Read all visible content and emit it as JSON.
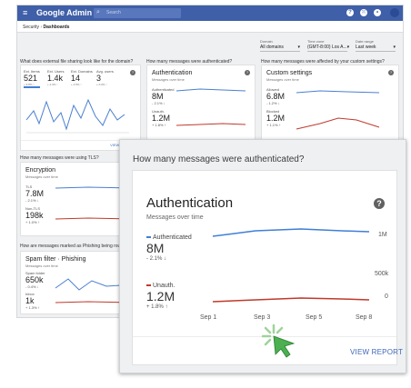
{
  "topbar": {
    "brand": "Google Admin",
    "search_placeholder": "Search",
    "icons": [
      "help-icon",
      "apps-icon",
      "notifications-icon"
    ],
    "colors": {
      "header": "#3f5fa8",
      "accent": "#3f7fd6",
      "unauth": "#c0392b"
    }
  },
  "breadcrumb": {
    "parent": "Security",
    "current": "Dashboards"
  },
  "filters": [
    {
      "label": "Domain",
      "value": "All domains"
    },
    {
      "label": "Time zone",
      "value": "(GMT-8:00) Los A..."
    },
    {
      "label": "Date range",
      "value": "Last week"
    }
  ],
  "dashboard": {
    "questions": {
      "external_sharing": "What does external file sharing look like for the domain?",
      "authenticated": "How many messages were authenticated?",
      "custom": "How many messages were affected by your custom settings?",
      "tls": "How many messages were using TLS?",
      "phishing": "How are messages marked as Phishing being routed?"
    },
    "sharing_stats": [
      {
        "label": "Ext. Items",
        "value": "521",
        "change": "+ 9.8% ↑"
      },
      {
        "label": "Ext. Users",
        "value": "1.4k",
        "change": "+ 2.3% ↑"
      },
      {
        "label": "Ext. Domains",
        "value": "14",
        "change": "+ 4.5% ↑"
      },
      {
        "label": "Avg. users",
        "value": "3",
        "change": "+ 0.0% ↑"
      }
    ],
    "small_auth": {
      "title": "Authentication",
      "subtitle": "Messages over time",
      "a_label": "Authenticated",
      "a_value": "8M",
      "a_change": "- 2.1% ↓",
      "u_label": "Unauth.",
      "u_value": "1.2M",
      "u_change": "+ 1.8% ↑",
      "view": "VIEW REPORT"
    },
    "custom": {
      "title": "Custom settings",
      "subtitle": "Messages over time",
      "a_label": "Allowed",
      "a_value": "6.8M",
      "a_change": "- 1.2% ↓",
      "b_label": "Blocked",
      "b_value": "1.2M",
      "b_change": "+ 1.1% ↑",
      "view": "VIEW REPORT"
    },
    "tls": {
      "title": "Encryption",
      "subtitle": "Messages over time",
      "a_label": "TLS",
      "a_value": "7.8M",
      "a_change": "- 2.1% ↓",
      "b_label": "Non-TLS",
      "b_value": "198k",
      "b_change": "+ 1.0% ↑"
    },
    "spam": {
      "title": "Spam filter · Phishing",
      "subtitle": "Messages over time",
      "a_label": "Spam folder",
      "a_value": "650k",
      "a_change": "- 0.4% ↓",
      "b_label": "Inbox",
      "b_value": "1k",
      "b_change": "+ 1.3% ↑"
    },
    "sharing_view": "VIEW REPORT"
  },
  "zoom": {
    "question": "How many messages were authenticated?",
    "title": "Authentication",
    "subtitle": "Messages over time",
    "help": "?",
    "authenticated_label": "Authenticated",
    "authenticated_value": "8M",
    "authenticated_change": "- 2.1% ↓",
    "unauth_label": "Unauth.",
    "unauth_value": "1.2M",
    "unauth_change": "+ 1.8% ↑",
    "view_report": "VIEW REPORT",
    "axis_top": "1M",
    "axis_mid": "500k",
    "axis_bottom": "0",
    "x_ticks": [
      "Sep 1",
      "Sep 3",
      "Sep 5",
      "Sep 8"
    ]
  }
}
